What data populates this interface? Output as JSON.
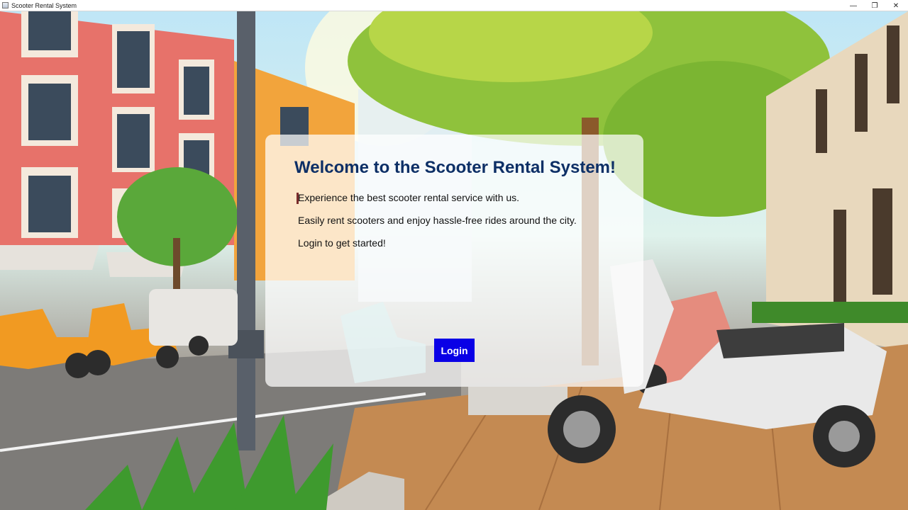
{
  "window": {
    "title": "Scooter Rental System",
    "minimize_glyph": "—",
    "maximize_glyph": "❐",
    "close_glyph": "✕"
  },
  "welcome": {
    "title": "Welcome to the Scooter Rental System!",
    "line1": "Experience the best scooter rental service with us.",
    "line2": "Easily rent scooters and enjoy hassle-free rides around the city.",
    "line3": "Login to get started!",
    "login_label": "Login"
  },
  "colors": {
    "title": "#0d2f66",
    "login_button": "#0a00e6",
    "panel": "rgba(255,255,255,0.72)"
  }
}
